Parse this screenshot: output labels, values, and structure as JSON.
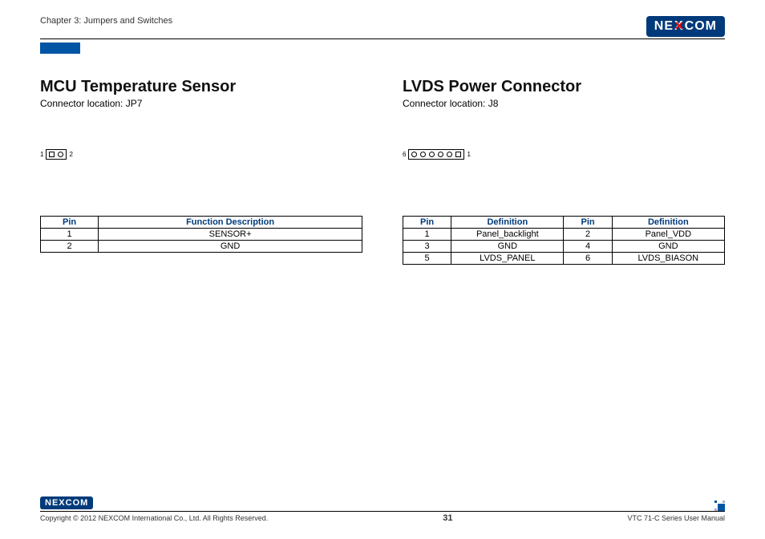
{
  "header": {
    "chapter": "Chapter 3: Jumpers and Switches",
    "logo_text_left": "NE",
    "logo_text_mid": "X",
    "logo_text_right": "COM"
  },
  "left": {
    "title": "MCU Temperature Sensor",
    "subtitle": "Connector location: JP7",
    "diag_left_label": "1",
    "diag_right_label": "2",
    "table": {
      "h1": "Pin",
      "h2": "Function Description",
      "rows": [
        {
          "pin": "1",
          "func": "SENSOR+"
        },
        {
          "pin": "2",
          "func": "GND"
        }
      ]
    }
  },
  "right": {
    "title": "LVDS Power Connector",
    "subtitle": "Connector location: J8",
    "diag_left_label": "6",
    "diag_right_label": "1",
    "table": {
      "h1": "Pin",
      "h2": "Definition",
      "h3": "Pin",
      "h4": "Definition",
      "rows": [
        {
          "p1": "1",
          "d1": "Panel_backlight",
          "p2": "2",
          "d2": "Panel_VDD"
        },
        {
          "p1": "3",
          "d1": "GND",
          "p2": "4",
          "d2": "GND"
        },
        {
          "p1": "5",
          "d1": "LVDS_PANEL",
          "p2": "6",
          "d2": "LVDS_BIASON"
        }
      ]
    }
  },
  "footer": {
    "copyright": "Copyright © 2012 NEXCOM International Co., Ltd. All Rights Reserved.",
    "page": "31",
    "manual": "VTC 71-C Series User Manual"
  }
}
